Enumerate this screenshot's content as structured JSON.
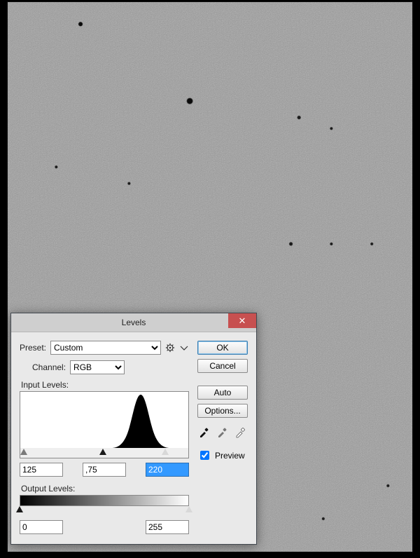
{
  "dialog": {
    "title": "Levels",
    "preset_label": "Preset:",
    "preset_value": "Custom",
    "channel_label": "Channel:",
    "channel_value": "RGB",
    "input_levels_label": "Input Levels:",
    "output_levels_label": "Output Levels:",
    "input_black": "125",
    "input_gamma": ",75",
    "input_white": "220",
    "output_black": "0",
    "output_white": "255",
    "buttons": {
      "ok": "OK",
      "cancel": "Cancel",
      "auto": "Auto",
      "options": "Options..."
    },
    "preview_label": "Preview",
    "preview_checked": true
  }
}
